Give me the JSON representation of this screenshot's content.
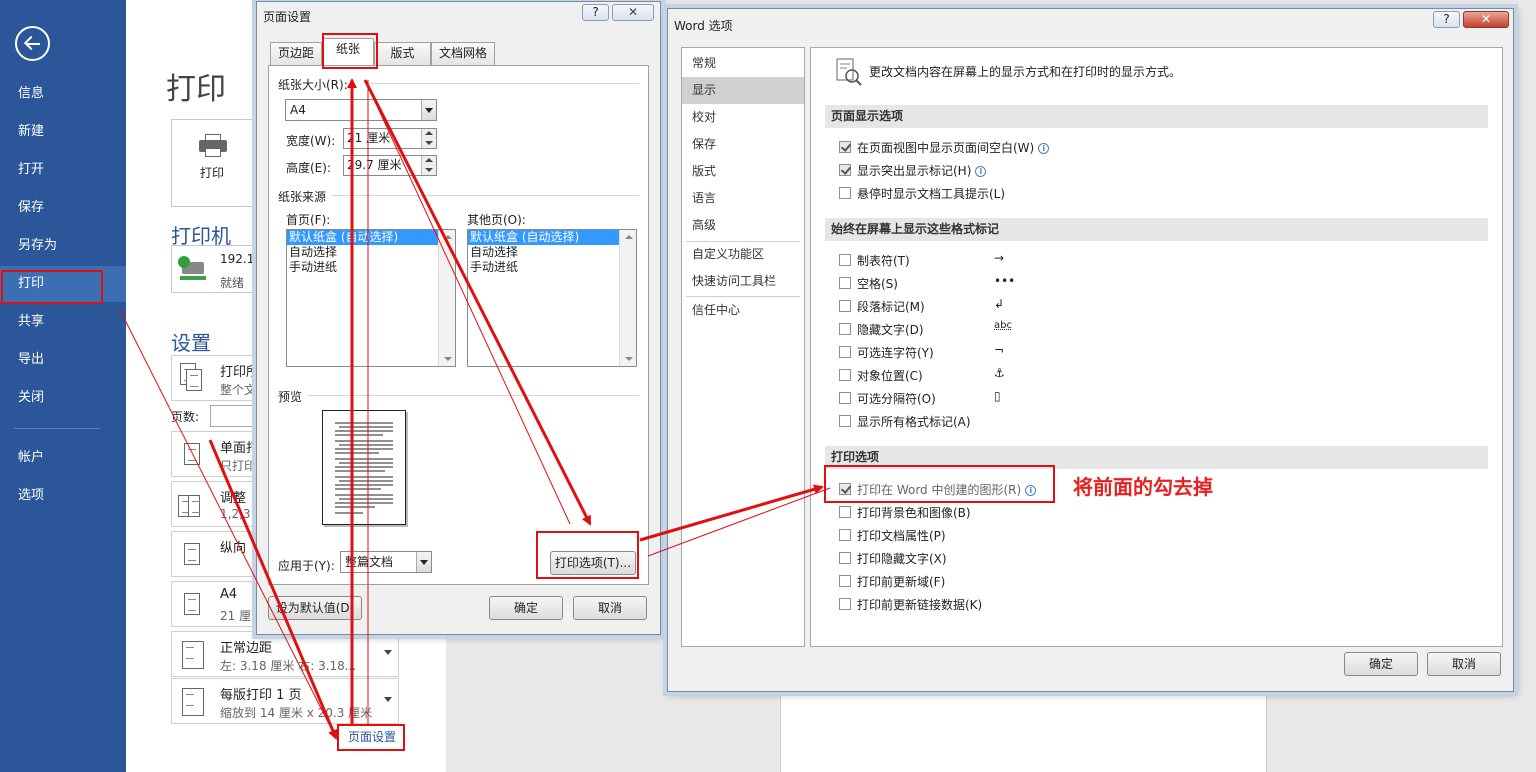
{
  "sidebar": {
    "items": [
      {
        "label": "信息"
      },
      {
        "label": "新建"
      },
      {
        "label": "打开"
      },
      {
        "label": "保存"
      },
      {
        "label": "另存为"
      },
      {
        "label": "打印"
      },
      {
        "label": "共享"
      },
      {
        "label": "导出"
      },
      {
        "label": "关闭"
      },
      {
        "label": "帐户"
      },
      {
        "label": "选项"
      }
    ],
    "active": "打印",
    "back_icon": "arrow-left-circle-icon"
  },
  "print_panel": {
    "title": "打印",
    "print_button": "打印",
    "printer_heading": "打印机",
    "printer_name": "192.1",
    "printer_status": "就绪",
    "settings_heading": "设置",
    "pages_label": "页数:",
    "settings": [
      {
        "line1": "打印所",
        "line2": "整个文"
      },
      {
        "line1": "单面打",
        "line2": "只打印"
      },
      {
        "line1": "调整",
        "line2": "1,2,3"
      },
      {
        "line1": "纵向",
        "line2": ""
      },
      {
        "line1": "A4",
        "line2": "21 厘"
      },
      {
        "line1": "正常边距",
        "line2": "左: 3.18 厘米    右: 3.18..."
      },
      {
        "line1": "每版打印 1 页",
        "line2": "缩放到 14 厘米 x 20.3 厘米"
      }
    ],
    "page_setup_link": "页面设置"
  },
  "page_setup": {
    "title": "页面设置",
    "help": "?",
    "close": "✕",
    "tabs": [
      "页边距",
      "纸张",
      "版式",
      "文档网格"
    ],
    "active_tab": "纸张",
    "paper_size_group": "纸张大小(R):",
    "paper_size_value": "A4",
    "width_label": "宽度(W):",
    "width_value": "21 厘米",
    "height_label": "高度(E):",
    "height_value": "29.7 厘米",
    "paper_source_group": "纸张来源",
    "first_page_label": "首页(F):",
    "other_pages_label": "其他页(O):",
    "source_options": [
      "默认纸盒 (自动选择)",
      "自动选择",
      "手动进纸"
    ],
    "preview_group": "预览",
    "apply_to_label": "应用于(Y):",
    "apply_to_value": "整篇文档",
    "print_options_button": "打印选项(T)...",
    "set_default_button": "设为默认值(D)",
    "ok_button": "确定",
    "cancel_button": "取消"
  },
  "word_options": {
    "title": "Word 选项",
    "help": "?",
    "close": "✕",
    "nav": [
      "常规",
      "显示",
      "校对",
      "保存",
      "版式",
      "语言",
      "高级",
      "自定义功能区",
      "快速访问工具栏",
      "信任中心"
    ],
    "active_nav": "显示",
    "header_text": "更改文档内容在屏幕上的显示方式和在打印时的显示方式。",
    "sections": {
      "page_display": {
        "title": "页面显示选项",
        "options": [
          {
            "label": "在页面视图中显示页面间空白(W)",
            "checked": true,
            "info": true
          },
          {
            "label": "显示突出显示标记(H)",
            "checked": true,
            "info": true
          },
          {
            "label": "悬停时显示文档工具提示(L)",
            "checked": false,
            "info": false
          }
        ]
      },
      "format_marks": {
        "title": "始终在屏幕上显示这些格式标记",
        "options": [
          {
            "label": "制表符(T)",
            "symbol": "→"
          },
          {
            "label": "空格(S)",
            "symbol": "•••"
          },
          {
            "label": "段落标记(M)",
            "symbol": "↲"
          },
          {
            "label": "隐藏文字(D)",
            "symbol": "abc"
          },
          {
            "label": "可选连字符(Y)",
            "symbol": "¬"
          },
          {
            "label": "对象位置(C)",
            "symbol": "⚓"
          },
          {
            "label": "可选分隔符(O)",
            "symbol": "▯"
          },
          {
            "label": "显示所有格式标记(A)",
            "symbol": ""
          }
        ]
      },
      "print": {
        "title": "打印选项",
        "options": [
          {
            "label": "打印在 Word 中创建的图形(R)",
            "checked": true,
            "info": true
          },
          {
            "label": "打印背景色和图像(B)",
            "checked": false
          },
          {
            "label": "打印文档属性(P)",
            "checked": false
          },
          {
            "label": "打印隐藏文字(X)",
            "checked": false
          },
          {
            "label": "打印前更新域(F)",
            "checked": false
          },
          {
            "label": "打印前更新链接数据(K)",
            "checked": false
          }
        ]
      }
    },
    "ok_button": "确定",
    "cancel_button": "取消"
  },
  "annotation": {
    "text": "将前面的勾去掉",
    "color": "#e01010"
  }
}
